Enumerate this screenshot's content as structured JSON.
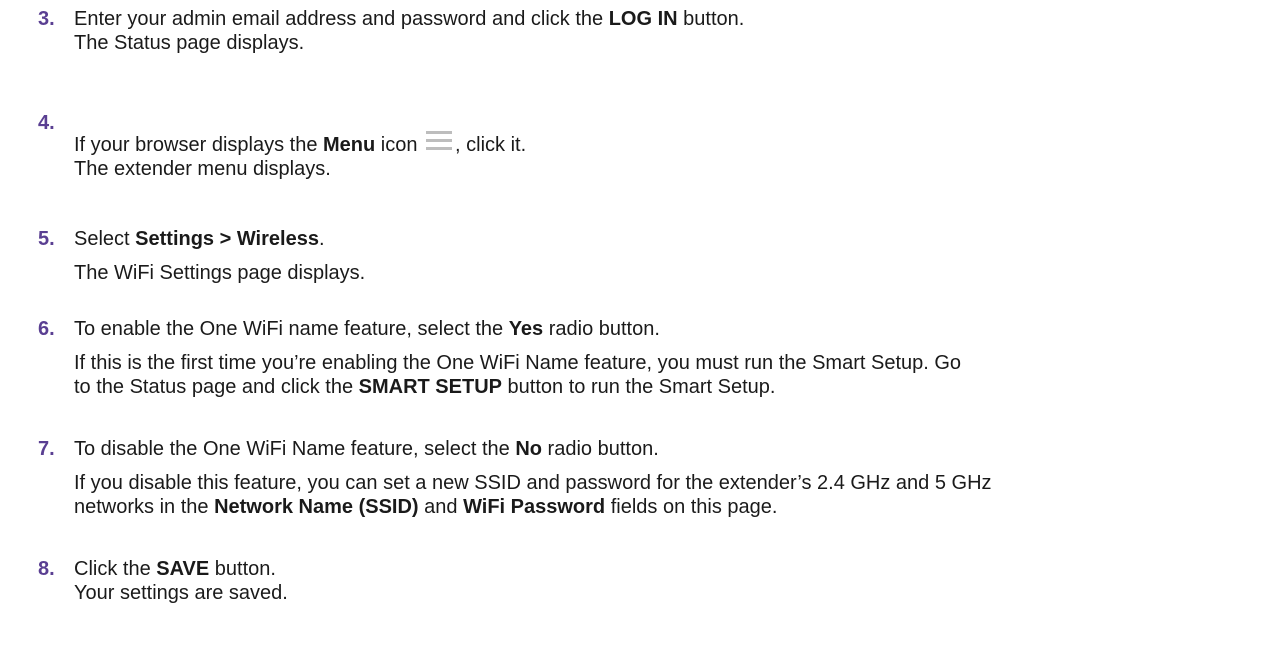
{
  "steps": [
    {
      "num": "3.",
      "l1a": "Enter your admin email address and password and click the ",
      "l1b": "LOG IN",
      "l1c": " button.",
      "l2": "The Status page displays."
    },
    {
      "num": "4.",
      "l1a": "If your browser displays the ",
      "l1b": "Menu",
      "l1c": " icon ",
      "l1d": ", click it.",
      "l2": "The extender menu displays.",
      "icon": "menu-icon"
    },
    {
      "num": "5.",
      "l1a": "Select ",
      "l1b": "Settings > Wireless",
      "l1c": ".",
      "l2": "The WiFi Settings page displays."
    },
    {
      "num": "6.",
      "l1a": "To enable the One WiFi name feature, select the ",
      "l1b": "Yes",
      "l1c": " radio button.",
      "l2": "If this is the first time you’re enabling the One WiFi Name feature, you must run the Smart Setup. Go",
      "l3a": "to the Status page and click the ",
      "l3b": "SMART SETUP",
      "l3c": " button to run the Smart Setup."
    },
    {
      "num": "7.",
      "l1a": "To disable the One WiFi Name feature, select the ",
      "l1b": "No",
      "l1c": " radio button.",
      "l2": "If you disable this feature, you can set a new SSID and password for the extender’s 2.4 GHz and 5 GHz",
      "l3a": "networks in the ",
      "l3b": "Network Name (SSID)",
      "l3c": " and ",
      "l3d": "WiFi Password",
      "l3e": " fields on this page."
    },
    {
      "num": "8.",
      "l1a": "Click the ",
      "l1b": "SAVE",
      "l1c": " button.",
      "l2": "Your settings are saved."
    }
  ],
  "colors": {
    "step_number": "#5a3f92",
    "text": "#1a1a1a",
    "menu_icon": "#bdbdbd"
  }
}
